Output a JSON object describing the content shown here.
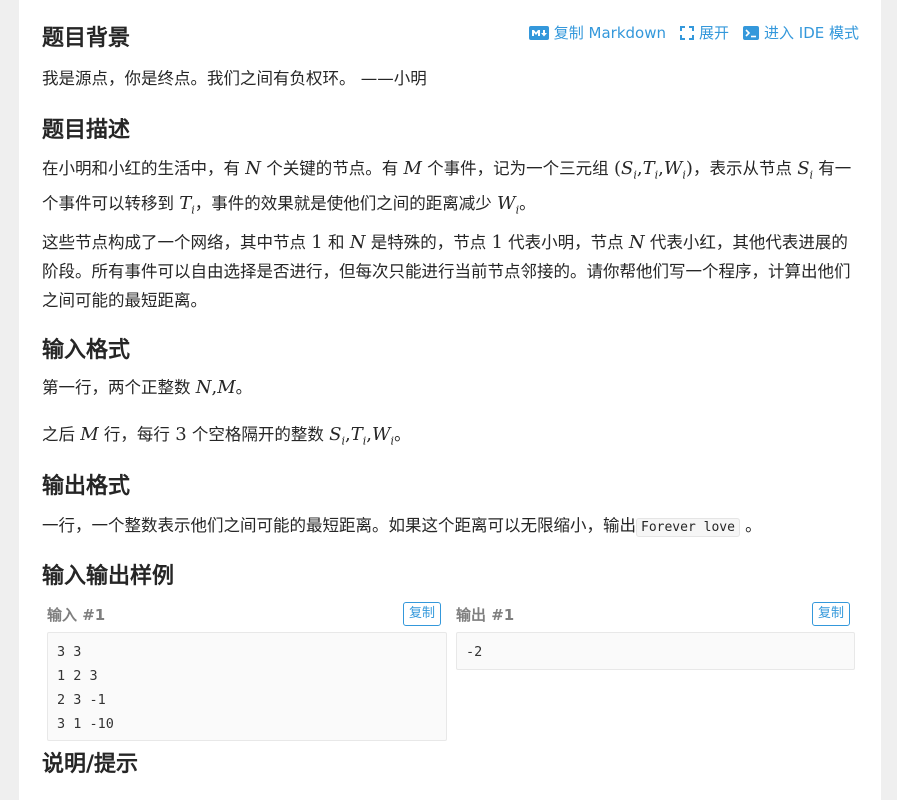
{
  "toolbar": {
    "copy_markdown": "复制 Markdown",
    "expand": "展开",
    "ide_mode": "进入 IDE 模式",
    "md_badge": "M↓"
  },
  "sections": {
    "background": {
      "title": "题目背景",
      "text": "我是源点，你是终点。我们之间有负权环。 ——小明"
    },
    "description": {
      "title": "题目描述",
      "p1_a": "在小明和小红的生活中，有 ",
      "p1_N": "N",
      "p1_b": " 个关键的节点。有 ",
      "p1_M": "M",
      "p1_c": " 个事件，记为一个三元组 ",
      "p1_triple": "(S",
      "p1_d": "，表示从节点 ",
      "p1_e": " 有一个事件可以转移到 ",
      "p1_f": "，事件的效果就是使他们之间的距离减少 ",
      "p1_g": "。",
      "p2_a": "这些节点构成了一个网络，其中节点 ",
      "p2_1": "1",
      "p2_b": " 和 ",
      "p2_N": "N",
      "p2_c": " 是特殊的，节点 ",
      "p2_d": " 代表小明，节点 ",
      "p2_e": " 代表小红，其他代表进展的阶段。所有事件可以自由选择是否进行，但每次只能进行当前节点邻接的。请你帮他们写一个程序，计算出他们之间可能的最短距离。"
    },
    "input": {
      "title": "输入格式",
      "l1_a": "第一行，两个正整数 ",
      "l1_b": "。",
      "l2_a": "之后 ",
      "l2_b": " 行，每行 ",
      "l2_3": "3",
      "l2_c": " 个空格隔开的整数 ",
      "l2_d": "。"
    },
    "output": {
      "title": "输出格式",
      "text_a": "一行，一个整数表示他们之间可能的最短距离。如果这个距离可以无限缩小，输出",
      "code": "Forever love",
      "text_b": " 。"
    },
    "samples": {
      "title": "输入输出样例",
      "input_label": "输入 #1",
      "output_label": "输出 #1",
      "copy": "复制",
      "input_lines": [
        "3 3",
        "1 2 3",
        "2 3 -1",
        "3 1 -10"
      ],
      "output_lines": [
        "-2"
      ]
    },
    "hint": {
      "title": "说明/提示"
    }
  },
  "math": {
    "S": "S",
    "T": "T",
    "W": "W",
    "i": "i",
    "comma": ",",
    "rparen": ")",
    "lparen": "("
  },
  "colors": {
    "accent": "#3498db",
    "background": "#efefef",
    "card": "#ffffff"
  }
}
